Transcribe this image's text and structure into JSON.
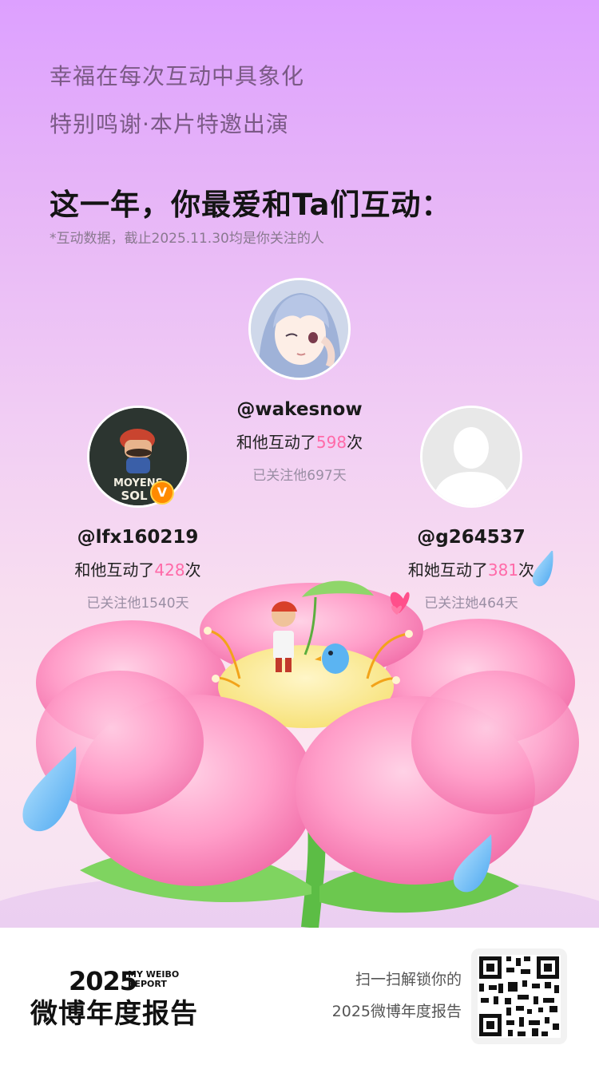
{
  "header": {
    "line1": "幸福在每次互动中具象化",
    "line2": "特别鸣谢·本片特邀出演",
    "headline": "这一年，你最爱和Ta们互动：",
    "note": "*互动数据，截止2025.11.30均是你关注的人"
  },
  "friends": [
    {
      "handle": "@wakesnow",
      "prefix": "和他互动了",
      "count": "598",
      "suffix": "次",
      "follow": "已关注他697天"
    },
    {
      "handle": "@lfx160219",
      "prefix": "和他互动了",
      "count": "428",
      "suffix": "次",
      "follow": "已关注他1540天",
      "badge": "V"
    },
    {
      "handle": "@g264537",
      "prefix": "和她互动了",
      "count": "381",
      "suffix": "次",
      "follow": "已关注她464天"
    }
  ],
  "avatar_text": {
    "line1": "MOYENS",
    "line2": "SOL"
  },
  "footer": {
    "year": "2025",
    "my_weibo": "MY WEIBO",
    "report": "REPORT",
    "title": "微博年度报告",
    "scan_line1": "扫一扫解锁你的",
    "scan_line2": "2025微博年度报告"
  },
  "colors": {
    "accent": "#ff6aa8",
    "petal": "#ff9cc8",
    "background_top": "#dda0ff"
  }
}
